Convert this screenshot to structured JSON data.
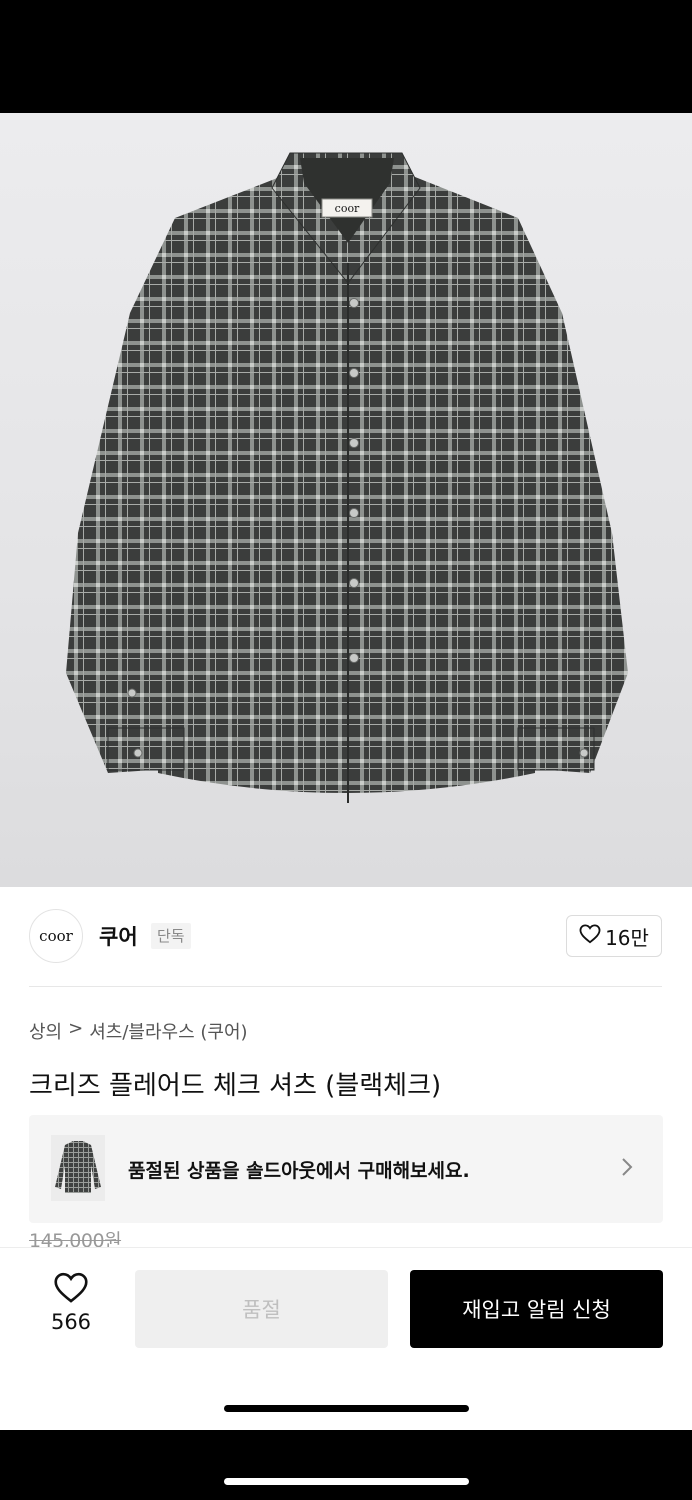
{
  "product_image": {
    "label_text": "coor"
  },
  "brand": {
    "logo_text": "coor",
    "name": "쿠어",
    "tag": "단독"
  },
  "like_pill": {
    "count": "16만"
  },
  "breadcrumb": {
    "category": "상의",
    "separator": ">",
    "subcategory": "셔츠/블라우스 (쿠어)"
  },
  "product": {
    "title": "크리즈 플레어드 체크 셔츠 (블랙체크)",
    "original_price": "145,000원"
  },
  "soldout_banner": {
    "text": "품절된 상품을 솔드아웃에서 구매해보세요."
  },
  "bottom_bar": {
    "wish_count": "566",
    "soldout_label": "품절",
    "restock_label": "재입고 알림 신청"
  },
  "colors": {
    "primary": "#000000",
    "disabled_bg": "#efefef",
    "disabled_text": "#bfbfbf"
  }
}
